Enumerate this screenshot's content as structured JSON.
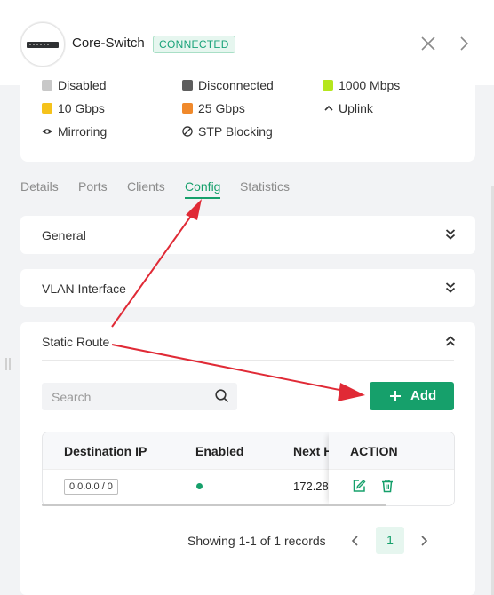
{
  "device": {
    "name": "Core-Switch",
    "status": "CONNECTED"
  },
  "legend": [
    {
      "label": "Disabled",
      "color": "#c8c8c8",
      "icon": "square"
    },
    {
      "label": "Disconnected",
      "color": "#5e5e5e",
      "icon": "square"
    },
    {
      "label": "1000 Mbps",
      "color": "#b5e61d",
      "icon": "square"
    },
    {
      "label": "10 Gbps",
      "color": "#f5c21b",
      "icon": "square"
    },
    {
      "label": "25 Gbps",
      "color": "#f0892b",
      "icon": "square"
    },
    {
      "label": "Uplink",
      "color": "#333333",
      "icon": "chevron-up-icon"
    },
    {
      "label": "Mirroring",
      "color": "#333333",
      "icon": "eye-icon"
    },
    {
      "label": "STP Blocking",
      "color": "#333333",
      "icon": "blocked-icon"
    }
  ],
  "tabs": [
    {
      "label": "Details"
    },
    {
      "label": "Ports"
    },
    {
      "label": "Clients"
    },
    {
      "label": "Config",
      "active": true
    },
    {
      "label": "Statistics"
    }
  ],
  "sections": {
    "general": {
      "title": "General",
      "expanded": false
    },
    "vlan": {
      "title": "VLAN Interface",
      "expanded": false
    },
    "static_route": {
      "title": "Static Route",
      "expanded": true
    }
  },
  "search": {
    "placeholder": "Search",
    "value": ""
  },
  "add_button": {
    "label": "Add"
  },
  "table": {
    "columns": [
      "Destination IP",
      "Enabled",
      "Next H",
      "ACTION"
    ],
    "rows": [
      {
        "destination_ip": "0.0.0.0 / 0",
        "enabled": true,
        "next_hop": "172.28"
      }
    ]
  },
  "pagination": {
    "summary": "Showing 1-1 of 1 records",
    "current_page": "1"
  },
  "colors": {
    "accent": "#16a06b",
    "annotation_arrow": "#e02a36"
  }
}
